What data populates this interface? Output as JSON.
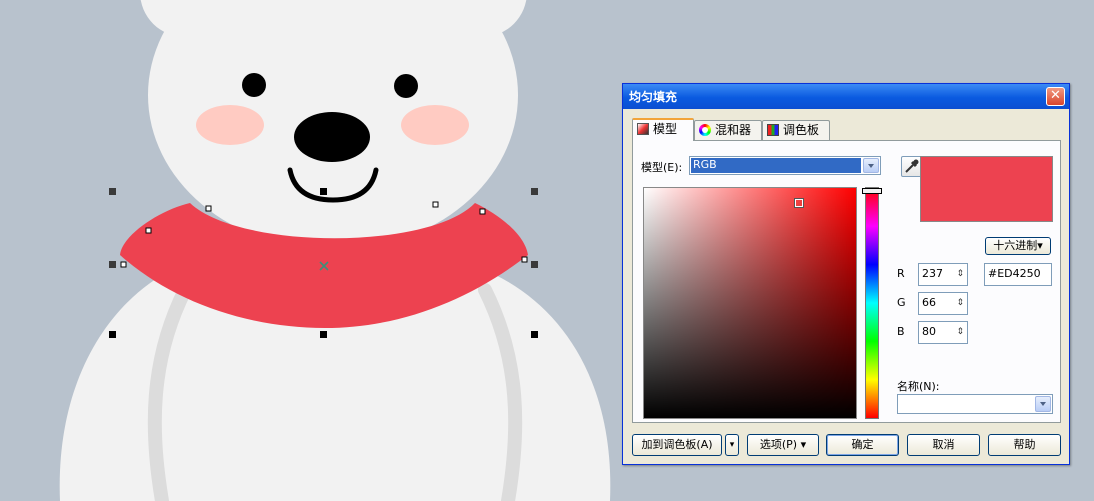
{
  "colors": {
    "background": "#b8c2cd",
    "bear_fur": "#f2f2f2",
    "bear_shadow": "#dcdcdc",
    "cheek": "#ffcbc2",
    "feature": "#000000",
    "scarf": "#ed4250",
    "hue_base": "#ff0000"
  },
  "dialog": {
    "title": "均匀填充",
    "close_label": "✕",
    "tabs": [
      {
        "label": "模型",
        "icon": "model-icon"
      },
      {
        "label": "混和器",
        "icon": "mixer-icon"
      },
      {
        "label": "调色板",
        "icon": "palette-icon"
      }
    ],
    "model_label": "模型(E):",
    "model_value": "RGB",
    "eyedropper_icon": "eyedropper-icon",
    "hex_button": "十六进制",
    "hex_value": "#ED4250",
    "channels": [
      {
        "label": "R",
        "value": "237"
      },
      {
        "label": "G",
        "value": "66"
      },
      {
        "label": "B",
        "value": "80"
      }
    ],
    "spin_glyph": "⇕",
    "name_label": "名称(N):",
    "name_value": "",
    "buttons": {
      "add_palette": "加到调色板(A)",
      "options": "选项(P)",
      "ok": "确定",
      "cancel": "取消",
      "help": "帮助"
    },
    "dropdown_glyph": "▾"
  }
}
